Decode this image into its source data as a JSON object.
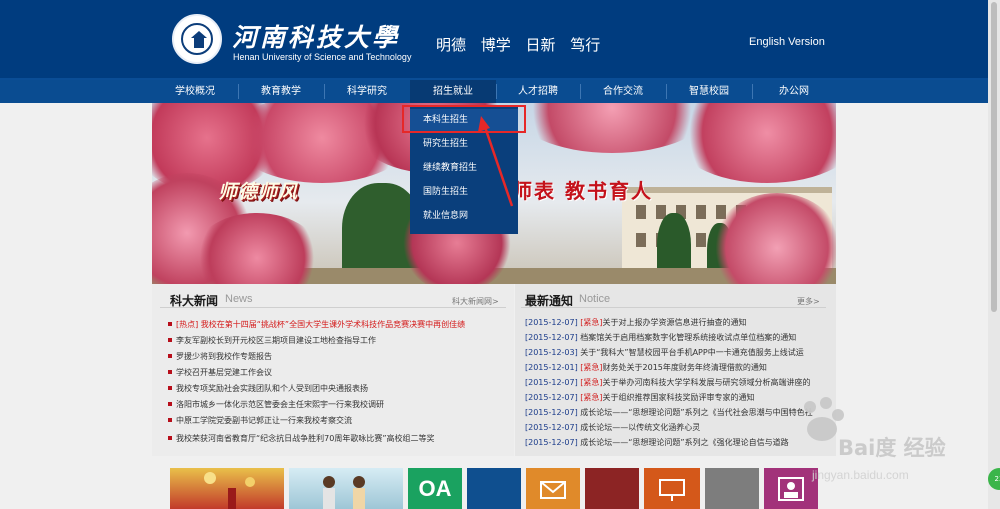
{
  "header": {
    "university_cn": "河南科技大學",
    "university_en": "Henan University of Science and Technology",
    "motto": "明德 博学 日新 笃行",
    "english_version": "English Version"
  },
  "nav": {
    "items": [
      {
        "label": "学校概况"
      },
      {
        "label": "教育教学"
      },
      {
        "label": "科学研究"
      },
      {
        "label": "招生就业"
      },
      {
        "label": "人才招聘"
      },
      {
        "label": "合作交流"
      },
      {
        "label": "智慧校园"
      },
      {
        "label": "办公网"
      }
    ],
    "active_index": 3
  },
  "dropdown": {
    "items": [
      {
        "label": "本科生招生"
      },
      {
        "label": "研究生招生"
      },
      {
        "label": "继续教育招生"
      },
      {
        "label": "国防生招生"
      },
      {
        "label": "就业信息网"
      }
    ],
    "highlighted_index": 0
  },
  "banner": {
    "slogan_left": "师德师风",
    "slogan_right": "师表  教书育人"
  },
  "news": {
    "title": "科大新闻",
    "subtitle": "News",
    "more": "科大新闻网>",
    "items": [
      {
        "text": "[热点] 我校在第十四届“挑战杯”全国大学生课外学术科技作品竞赛决赛中再创佳绩",
        "hot": true
      },
      {
        "text": "李友军副校长到开元校区三期项目建设工地检查指导工作",
        "hot": false
      },
      {
        "text": "罗援少将到我校作专题报告",
        "hot": false
      },
      {
        "text": "学校召开基层党建工作会议",
        "hot": false
      },
      {
        "text": "我校专项奖励社会实践团队和个人受到团中央通报表扬",
        "hot": false
      },
      {
        "text": "洛阳市城乡一体化示范区管委会主任宋熙宇一行来我校调研",
        "hot": false
      },
      {
        "text": "中原工学院党委副书记郭正让一行来我校考察交流",
        "hot": false
      },
      {
        "text": "我校荣获河南省教育厅“纪念抗日战争胜利70周年歌咏比赛”高校组二等奖",
        "hot": false
      }
    ]
  },
  "notice": {
    "title": "最新通知",
    "subtitle": "Notice",
    "more": "更多>",
    "items": [
      {
        "date": "[2015-12-07]",
        "tag": "[紧急]",
        "text": "关于对上报办学资源信息进行抽查的通知"
      },
      {
        "date": "[2015-12-07]",
        "tag": "",
        "text": "档案馆关于启用档案数字化管理系统接收试点单位档案的通知"
      },
      {
        "date": "[2015-12-03]",
        "tag": "",
        "text": "关于“我科大”智慧校园平台手机APP中一卡通充值服务上线试运"
      },
      {
        "date": "[2015-12-01]",
        "tag": "[紧急]",
        "text": "财务处关于2015年度财务年终清理借款的通知"
      },
      {
        "date": "[2015-12-07]",
        "tag": "[紧急]",
        "text": "关于举办河南科技大学学科发展与研究领域分析高端讲座的"
      },
      {
        "date": "[2015-12-07]",
        "tag": "[紧急]",
        "text": "关于组织推荐国家科技奖励评审专家的通知"
      },
      {
        "date": "[2015-12-07]",
        "tag": "",
        "text": "成长论坛——“思想理论问题”系列之《当代社会思潮与中国特色社"
      },
      {
        "date": "[2015-12-07]",
        "tag": "",
        "text": "成长论坛——以传统文化涵养心灵"
      },
      {
        "date": "[2015-12-07]",
        "tag": "",
        "text": "成长论坛——“思想理论问题”系列之《强化理论自信与道路"
      }
    ]
  },
  "tiles": {
    "oa_label": "OA"
  },
  "watermark": {
    "cn": "Bai度 经验",
    "en": "jingyan.baidu.com"
  },
  "badge": "23"
}
